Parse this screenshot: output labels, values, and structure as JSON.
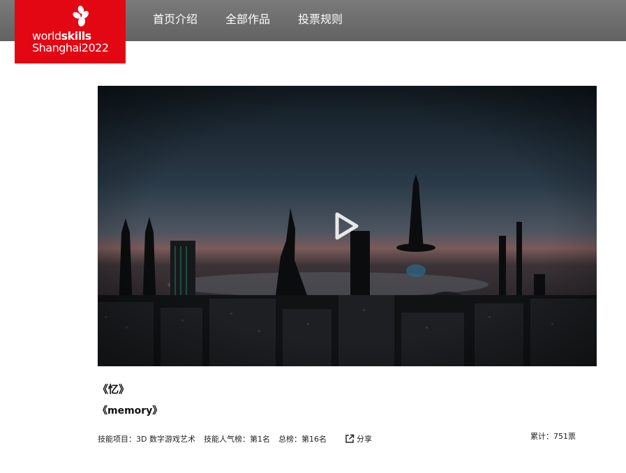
{
  "logo": {
    "line1_a": "world",
    "line1_b": "skills",
    "line2": "Shanghai2022"
  },
  "nav": {
    "items": [
      "首页介绍",
      "全部作品",
      "投票规则"
    ]
  },
  "video": {
    "play_icon": "play-icon"
  },
  "work": {
    "title_cn": "《忆》",
    "title_en": "《memory》",
    "skill_label": "技能项目：",
    "skill_value": "3D 数字游戏艺术",
    "skill_rank_label": "技能人气榜：",
    "skill_rank_value": "第1名",
    "total_rank_label": "总榜：",
    "total_rank_value": "第16名",
    "share_label": "分享",
    "votes_label": "累计：",
    "votes_value": "751票"
  },
  "colors": {
    "brand_red": "#e30613",
    "topbar_gray": "#6b6b6b"
  }
}
